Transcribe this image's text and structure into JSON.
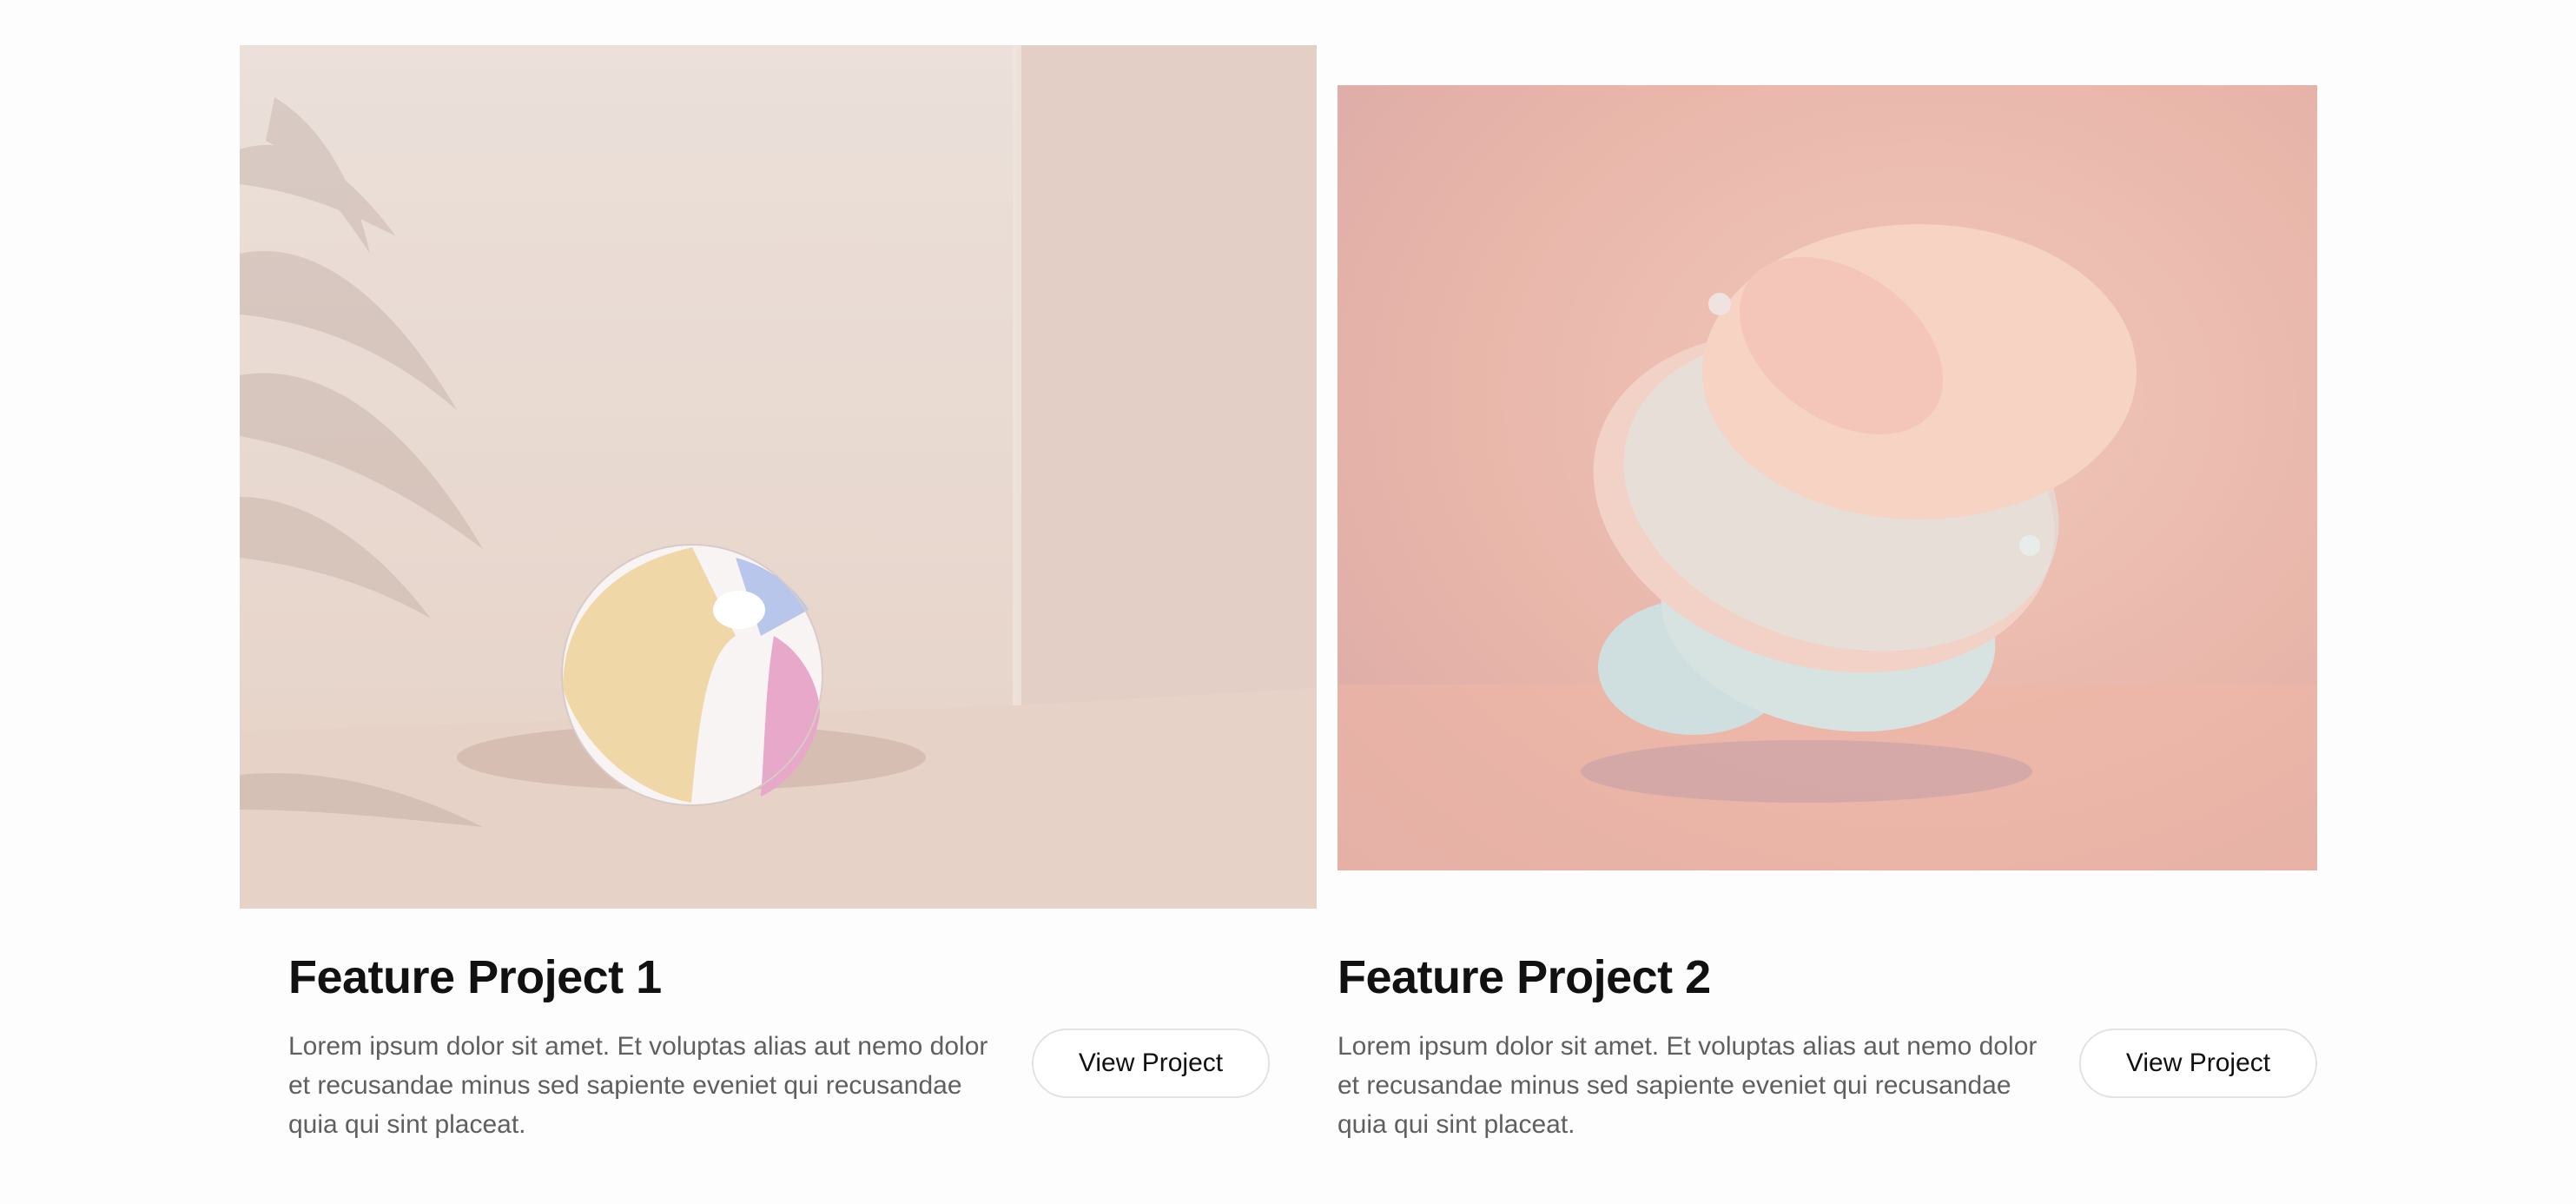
{
  "projects": [
    {
      "title": "Feature Project 1",
      "description": "Lorem ipsum dolor sit amet. Et voluptas alias aut nemo dolor et recusandae minus sed sapiente eveniet qui recusandae quia qui sint placeat.",
      "button_label": "View Project",
      "image_subject": "beach-ball"
    },
    {
      "title": "Feature Project 2",
      "description": "Lorem ipsum dolor sit amet. Et voluptas alias aut nemo dolor et recusandae minus sed sapiente eveniet qui recusandae quia qui sint placeat.",
      "button_label": "View Project",
      "image_subject": "floating-discs"
    }
  ],
  "colors": {
    "page_background": "#fdfdfd",
    "title_text": "#111111",
    "body_text": "#5f5f5f",
    "button_border": "#e2e2e2"
  }
}
